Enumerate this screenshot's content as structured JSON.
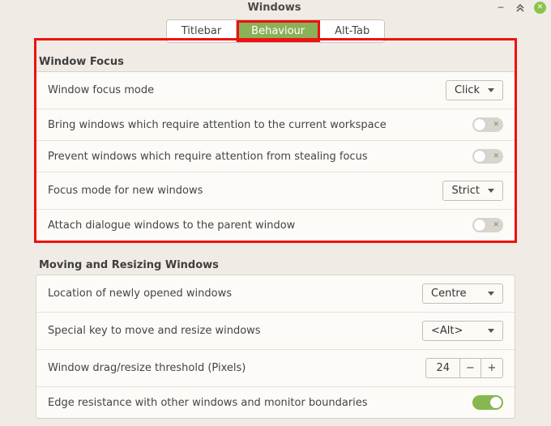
{
  "window": {
    "title": "Windows"
  },
  "tabs": {
    "titlebar": "Titlebar",
    "behaviour": "Behaviour",
    "alt_tab": "Alt-Tab",
    "active": "behaviour"
  },
  "sections": {
    "focus": {
      "title": "Window Focus",
      "rows": {
        "mode_label": "Window focus mode",
        "mode_value": "Click",
        "bring_label": "Bring windows which require attention to the current workspace",
        "bring_on": false,
        "prevent_label": "Prevent windows which require attention from stealing focus",
        "prevent_on": false,
        "newwin_label": "Focus mode for new windows",
        "newwin_value": "Strict",
        "attach_label": "Attach dialogue windows to the parent window",
        "attach_on": false
      }
    },
    "move": {
      "title": "Moving and Resizing Windows",
      "rows": {
        "location_label": "Location of newly opened windows",
        "location_value": "Centre",
        "special_label": "Special key to move and resize windows",
        "special_value": "<Alt>",
        "threshold_label": "Window drag/resize threshold (Pixels)",
        "threshold_value": "24",
        "edge_label": "Edge resistance with other windows and monitor boundaries",
        "edge_on": true
      }
    }
  },
  "highlight": {
    "tab": "behaviour",
    "section": "focus"
  }
}
